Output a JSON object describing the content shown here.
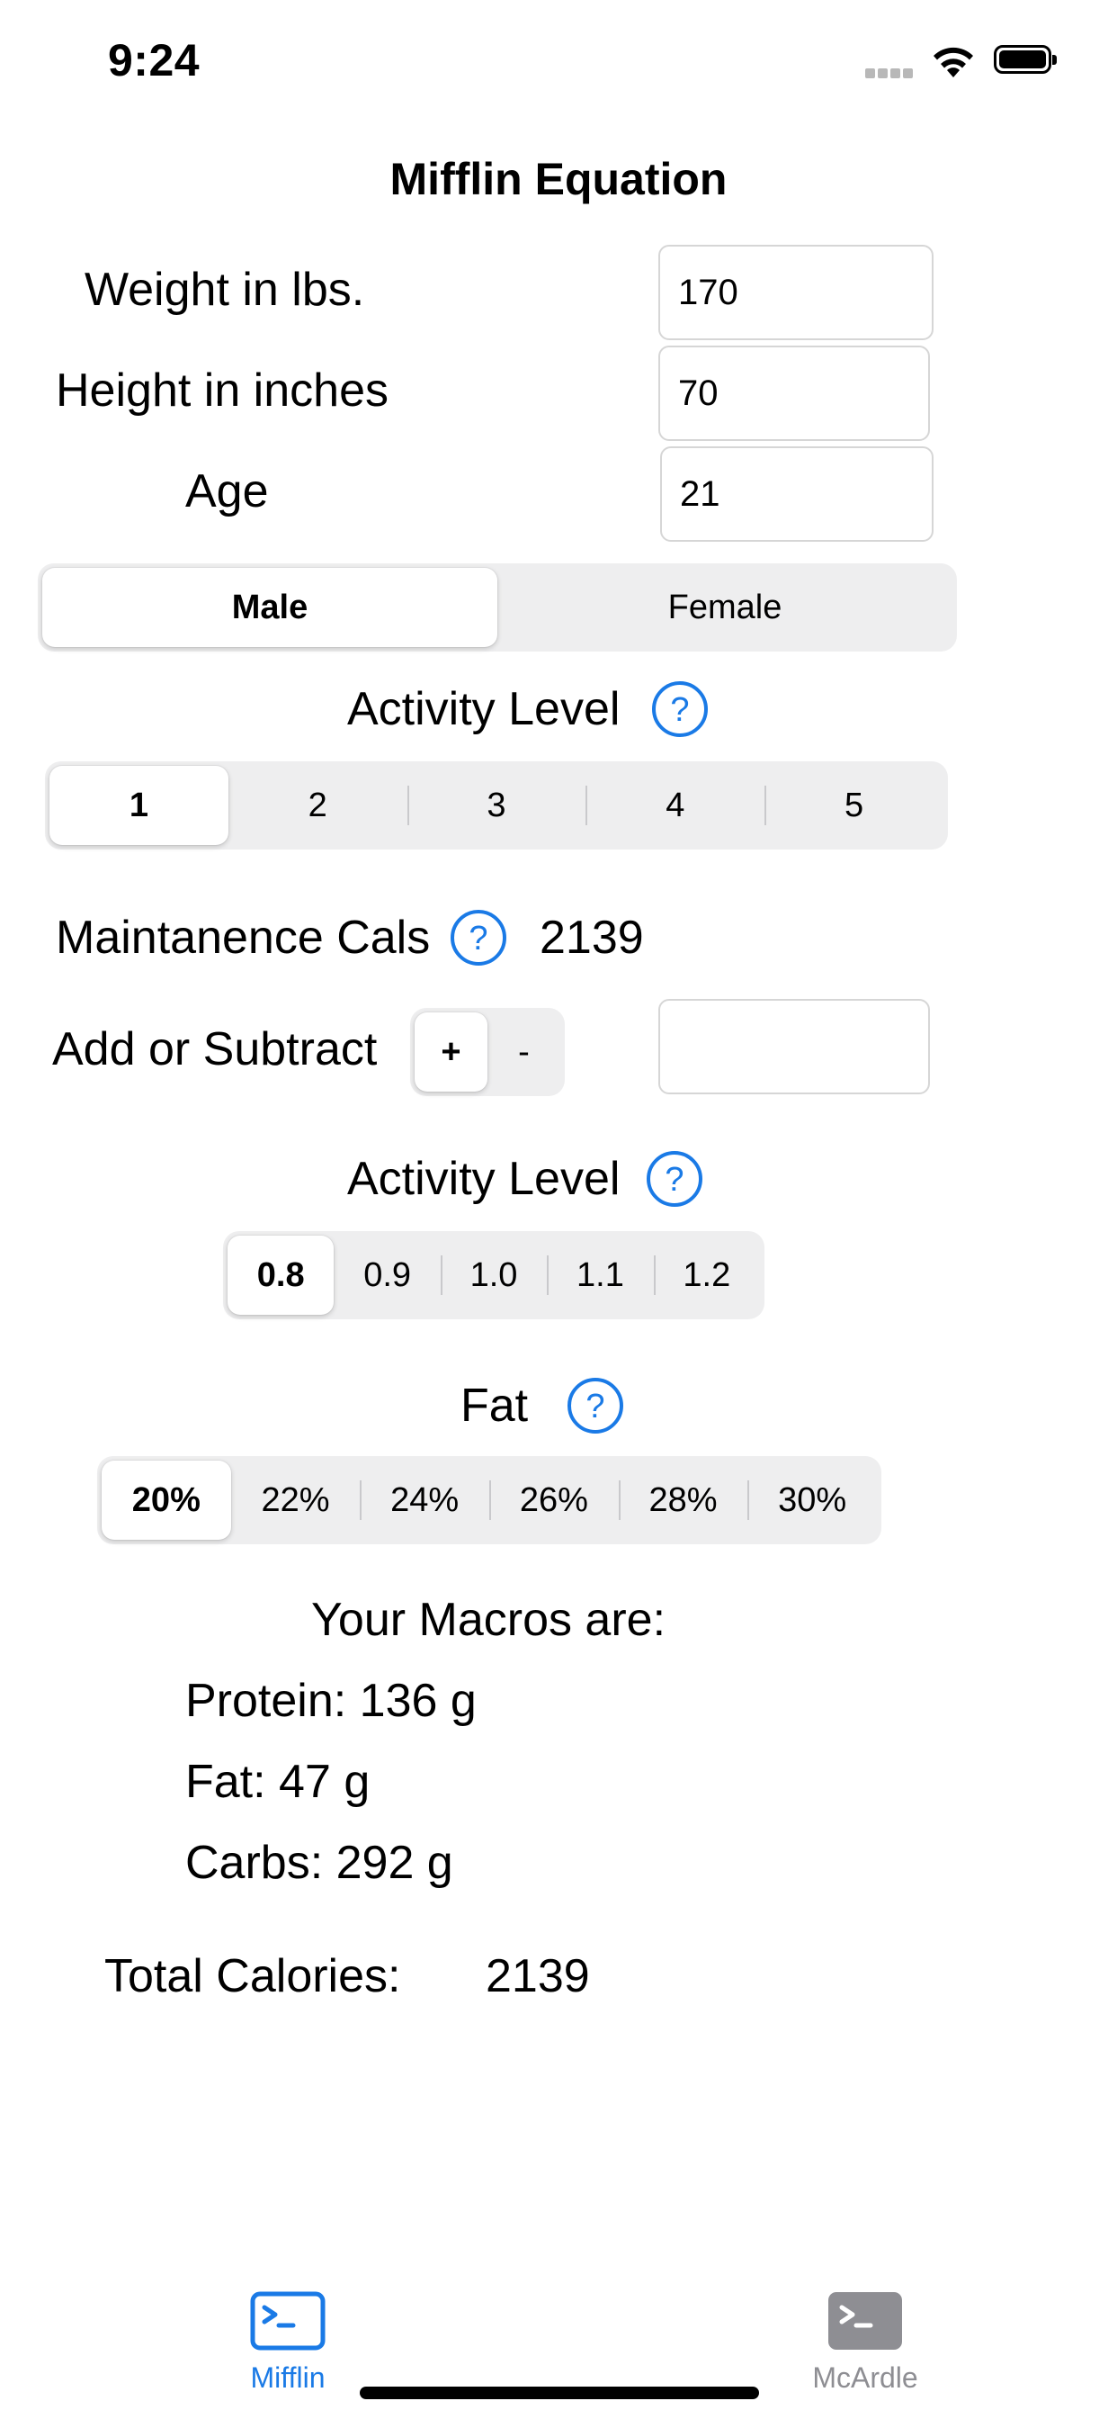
{
  "status": {
    "time": "9:24"
  },
  "title": "Mifflin Equation",
  "inputs": {
    "weight_label": "Weight in lbs.",
    "weight_value": "170",
    "height_label": "Height in inches",
    "height_value": "70",
    "age_label": "Age",
    "age_value": "21"
  },
  "sex": {
    "options": [
      "Male",
      "Female"
    ],
    "selected": "Male"
  },
  "activity1": {
    "label": "Activity Level",
    "options": [
      "1",
      "2",
      "3",
      "4",
      "5"
    ],
    "selected": "1"
  },
  "maintenance": {
    "label": "Maintanence Cals",
    "value": "2139"
  },
  "adjust": {
    "label": "Add or Subtract",
    "plus": "+",
    "minus": "-",
    "value": ""
  },
  "activity2": {
    "label": "Activity Level",
    "options": [
      "0.8",
      "0.9",
      "1.0",
      "1.1",
      "1.2"
    ],
    "selected": "0.8"
  },
  "fat": {
    "label": "Fat",
    "options": [
      "20%",
      "22%",
      "24%",
      "26%",
      "28%",
      "30%"
    ],
    "selected": "20%"
  },
  "macros": {
    "heading": "Your Macros are:",
    "protein": "Protein: 136 g",
    "fat": "Fat: 47 g",
    "carbs": "Carbs: 292 g"
  },
  "total": {
    "label": "Total Calories:",
    "value": "2139"
  },
  "tabbar": {
    "tabs": [
      {
        "label": "Mifflin",
        "icon": "terminal-icon",
        "active": true
      },
      {
        "label": "McArdle",
        "icon": "terminal-icon",
        "active": false
      }
    ]
  },
  "colors": {
    "accent": "#1a7ae6",
    "inactive": "#8e8e93",
    "segment_bg": "#eeeeef"
  }
}
